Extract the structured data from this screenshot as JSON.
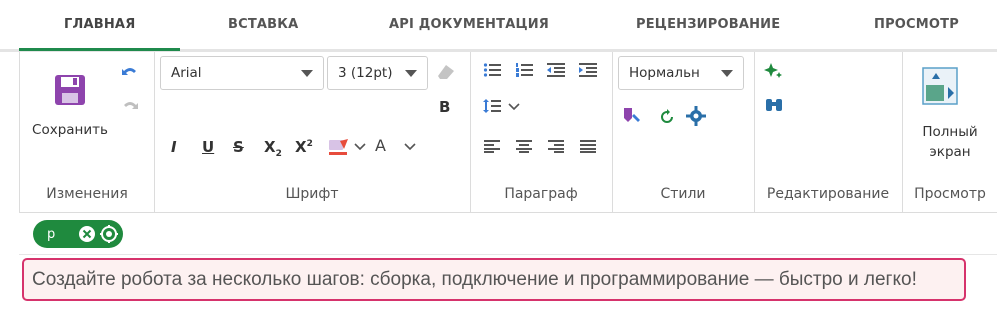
{
  "tabs": [
    {
      "label": "ГЛАВНАЯ",
      "active": true
    },
    {
      "label": "ВСТАВКА",
      "active": false
    },
    {
      "label": "API ДОКУМЕНТАЦИЯ",
      "active": false
    },
    {
      "label": "РЕЦЕНЗИРОВАНИЕ",
      "active": false
    },
    {
      "label": "ПРОСМОТР",
      "active": false
    }
  ],
  "ribbon": {
    "changes": {
      "label": "Изменения",
      "save_label": "Сохранить"
    },
    "font": {
      "label": "Шрифт",
      "font_family": "Arial",
      "font_size": "3 (12pt)",
      "bold": "B",
      "italic": "I",
      "underline": "U",
      "strikethrough": "S",
      "subscript": "X",
      "subscript_mark": "2",
      "superscript": "X",
      "superscript_mark": "2",
      "font_color": "A"
    },
    "paragraph": {
      "label": "Параграф"
    },
    "styles": {
      "label": "Стили",
      "style_value": "Нормальн"
    },
    "editing": {
      "label": "Редактирование"
    },
    "view": {
      "label": "Просмотр",
      "fullscreen_label_1": "Полный",
      "fullscreen_label_2": "экран"
    }
  },
  "tag": {
    "label": "p"
  },
  "content": {
    "text": "Создайте робота за несколько шагов: сборка, подключение и программирование — быстро и легко!"
  },
  "colors": {
    "accent_green": "#1f8a3e",
    "highlight_border": "#d6336c",
    "highlight_bg": "#fdf1f1",
    "icon_purple": "#8e44ad",
    "icon_blue": "#3a7bd5",
    "icon_teal": "#2a8a8a"
  }
}
